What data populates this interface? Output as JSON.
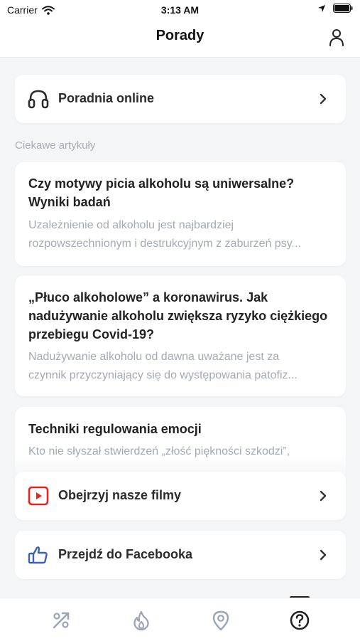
{
  "status_bar": {
    "carrier": "Carrier",
    "time": "3:13 AM"
  },
  "header": {
    "title": "Porady"
  },
  "counseling": {
    "label": "Poradnia online",
    "icon": "headphones-icon"
  },
  "articles_section": {
    "label": "Ciekawe artykuły",
    "articles": [
      {
        "title": "Czy motywy picia alkoholu są uniwersalne? Wyniki badań",
        "excerpt_lines": [
          "Uzależnienie od alkoholu jest najbardziej",
          "rozpowszechnionym i destrukcyjnym z zaburzeń psy..."
        ]
      },
      {
        "title": "„Płuco alkoholowe” a koronawirus. Jak nadużywanie alkoholu zwiększa ryzyko ciężkiego przebiegu Covid-19?",
        "excerpt_lines": [
          "Nadużywanie alkoholu od dawna uważane jest za",
          "czynnik przyczyniający się do występowania patofiz..."
        ]
      },
      {
        "title": "Techniki regulowania emocji",
        "excerpt_lines": [
          "Kto nie słyszał stwierdzeń „złość piękności szkodzi”,"
        ]
      }
    ]
  },
  "videos": {
    "label": "Obejrzyj nasze filmy",
    "icon": "youtube-icon",
    "accent": "#e52521"
  },
  "facebook": {
    "label": "Przejdź do Facebooka",
    "icon": "thumbs-up-icon",
    "accent": "#3c63b0"
  },
  "tabbar": {
    "tabs": [
      {
        "icon": "progress-icon",
        "active": false
      },
      {
        "icon": "flame-icon",
        "active": false
      },
      {
        "icon": "map-pin-icon",
        "active": false
      },
      {
        "icon": "help-icon",
        "active": true
      }
    ]
  },
  "colors": {
    "muted": "#a3aab2",
    "icon_inactive": "#9aa4b4",
    "text": "#222222",
    "background": "#f4f5f7"
  }
}
